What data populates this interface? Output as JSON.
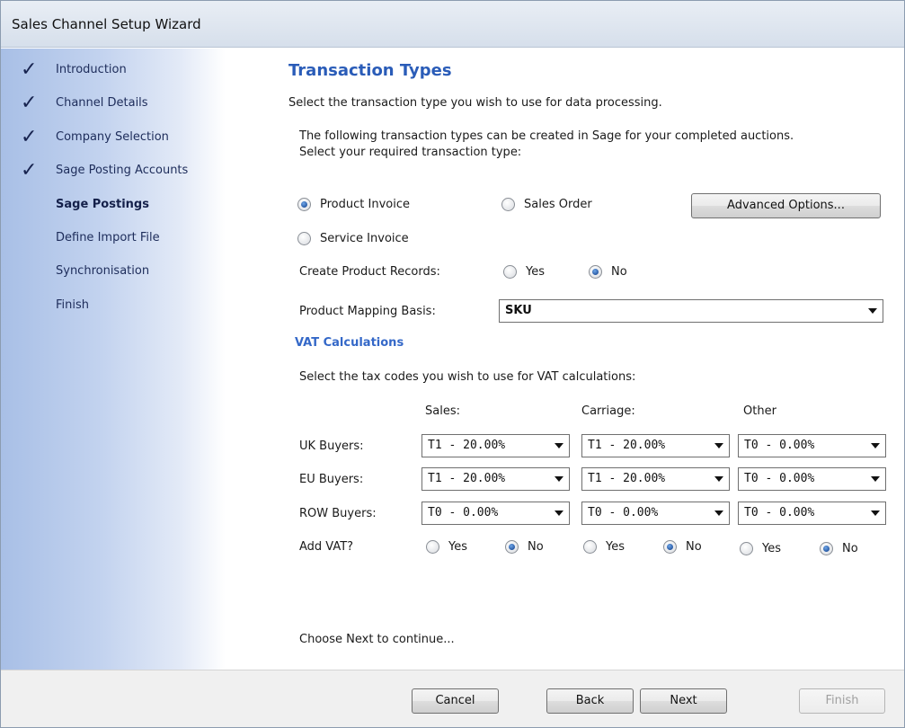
{
  "window": {
    "title": "Sales Channel Setup Wizard"
  },
  "sidebar": {
    "steps": [
      {
        "label": "Introduction",
        "checked": true
      },
      {
        "label": "Channel Details",
        "checked": true
      },
      {
        "label": "Company Selection",
        "checked": true
      },
      {
        "label": "Sage Posting Accounts",
        "checked": true
      },
      {
        "label": "Sage Postings",
        "checked": false,
        "current": true
      },
      {
        "label": "Define Import File",
        "checked": false
      },
      {
        "label": "Synchronisation",
        "checked": false
      },
      {
        "label": "Finish",
        "checked": false
      }
    ]
  },
  "main": {
    "heading": "Transaction Types",
    "intro": "Select the transaction type you wish to use for data processing.",
    "desc_line1": "The following transaction types can be created in Sage for your completed auctions.",
    "desc_line2": "Select your required transaction type:",
    "transaction_types": {
      "product_invoice": "Product Invoice",
      "sales_order": "Sales Order",
      "service_invoice": "Service Invoice",
      "selected": "Product Invoice"
    },
    "advanced_options_button": "Advanced Options...",
    "create_product_records": {
      "label": "Create Product Records:",
      "yes": "Yes",
      "no": "No",
      "selected": "No"
    },
    "product_mapping_basis": {
      "label": "Product Mapping Basis:",
      "value": "SKU"
    },
    "vat": {
      "heading": "VAT Calculations",
      "instruction": "Select the tax codes you wish to use for VAT calculations:",
      "columns": [
        "Sales:",
        "Carriage:",
        "Other"
      ],
      "rows": [
        {
          "label": "UK Buyers:",
          "sales": "T1 - 20.00%",
          "carriage": "T1 - 20.00%",
          "other": "T0 - 0.00%"
        },
        {
          "label": "EU Buyers:",
          "sales": "T1 - 20.00%",
          "carriage": "T1 - 20.00%",
          "other": "T0 - 0.00%"
        },
        {
          "label": "ROW Buyers:",
          "sales": "T0 - 0.00%",
          "carriage": "T0 - 0.00%",
          "other": "T0 - 0.00%"
        }
      ],
      "add_vat": {
        "label": "Add VAT?",
        "yes": "Yes",
        "no": "No",
        "sales": "No",
        "carriage": "No",
        "other": "No"
      }
    },
    "continue_text": "Choose Next to continue..."
  },
  "footer": {
    "cancel": "Cancel",
    "back": "Back",
    "next": "Next",
    "finish": "Finish"
  },
  "colors": {
    "heading": "#2a5cb8",
    "sidebar_gradient_start": "#a8bfe6",
    "check": "#17234f"
  }
}
